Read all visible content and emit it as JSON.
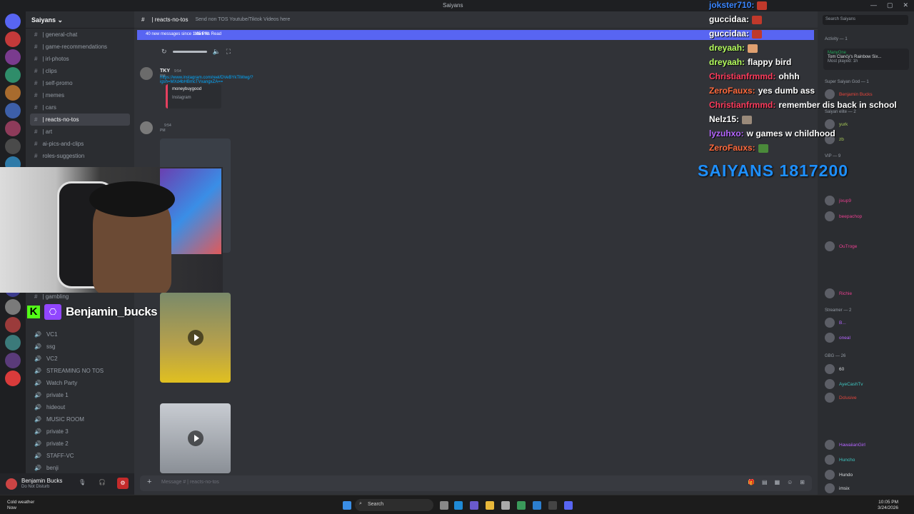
{
  "window": {
    "title": "Saiyans",
    "min": "—",
    "max": "▢",
    "close": "✕"
  },
  "guild": {
    "name": "Saiyans ⌄"
  },
  "channels": [
    {
      "name": "| general-chat"
    },
    {
      "name": "| game-recommendations"
    },
    {
      "name": "| irl-photos"
    },
    {
      "name": "| clips"
    },
    {
      "name": "| self-promo"
    },
    {
      "name": "| memes"
    },
    {
      "name": "| cars"
    },
    {
      "name": "| reacts-no-tos"
    },
    {
      "name": "| art"
    },
    {
      "name": "ai-pics-and-clips"
    },
    {
      "name": "roles-suggestion"
    }
  ],
  "gambling_channel": "| gambling",
  "voice_channels": [
    "VC1",
    "ssg",
    "VC2",
    "STREAMING NO TOS",
    "Watch Party",
    "private 1",
    "hideout",
    "MUSIC ROOM",
    "private 3",
    "private 2",
    "STAFF-VC",
    "benji"
  ],
  "user": {
    "name": "Benjamin Bucks",
    "status": "Do Not Disturb"
  },
  "channel_header": {
    "name": "| reacts-no-tos",
    "topic": "Send non TOS Youtube/Tiktok Videos here"
  },
  "new_messages": {
    "text": "40 new messages since 1:05 PM",
    "mark": "Mark As Read"
  },
  "messages": [
    {
      "author": "TKY",
      "time": "9:54 PM",
      "link": "https://www.instagram.com/reel/DVeBYkTiWwg/?igsh=MXd4bHBmcTVxangxZA==",
      "embed_author": "moneybuygood",
      "embed_site": "Instagram"
    },
    {
      "author": "",
      "time": "9:54 PM"
    }
  ],
  "composer": {
    "placeholder": "Message # | reacts-no-tos",
    "plus": "+"
  },
  "search": {
    "placeholder": "Search Saiyans"
  },
  "members": {
    "activity": "Activity — 1",
    "activity_user": "ManyOne_",
    "activity_game": "Tom Clancy's Rainbow Six...",
    "activity_sub": "Most played: 1h",
    "groups": [
      {
        "label": "Super Saiyan God — 1",
        "names": [
          "Benjamin Bucks"
        ]
      },
      {
        "label": "Saiyan elite — 2",
        "names": [
          "yurk",
          "zb"
        ]
      },
      {
        "label": "VIP — 9",
        "names": [
          "jixup9",
          "beepachop",
          "OuTroge",
          "Richie"
        ]
      },
      {
        "label": "Streamer — 2",
        "names": [
          "B...",
          "oneal"
        ]
      },
      {
        "label": "GBG — 26",
        "names": [
          "60",
          "AyeCashTv",
          "Dclusive",
          "HawaiianGirl",
          "Huncho",
          "Hundo",
          "imsix"
        ]
      }
    ]
  },
  "stream_overlay": {
    "chat": [
      {
        "user": "jokster710:",
        "msg": "",
        "color": "#3a86ff"
      },
      {
        "user": "guccidaa:",
        "msg": "",
        "color": "#ffffff"
      },
      {
        "user": "guccidaa:",
        "msg": "",
        "color": "#ffffff"
      },
      {
        "user": "dreyaah:",
        "msg": "",
        "color": "#b6ff5e"
      },
      {
        "user": "dreyaah:",
        "msg": "flappy bird",
        "color": "#b6ff5e"
      },
      {
        "user": "Christianfrmmd:",
        "msg": "ohhh",
        "color": "#ff3b5c"
      },
      {
        "user": "ZeroFauxs:",
        "msg": "yes dumb ass",
        "color": "#ff6a3d"
      },
      {
        "user": "Christianfrmmd:",
        "msg": "remember dis back in school",
        "color": "#ff3b5c"
      },
      {
        "user": "Nelz15:",
        "msg": "",
        "color": "#ffffff"
      },
      {
        "user": "lyzuhxo:",
        "msg": "w games w childhood",
        "color": "#b565ff"
      },
      {
        "user": "ZeroFauxs:",
        "msg": "",
        "color": "#ff6a3d"
      }
    ],
    "goal": "SAIYANS 1817200",
    "streamer_name": "Benjamin_bucks",
    "kick_letter": "K",
    "twitch_glyph": "⎔"
  },
  "taskbar": {
    "weather": "Cold weather",
    "weather_sub": "Now",
    "search": "Search",
    "time": "10:05 PM",
    "date": "3/24/2026"
  },
  "colors": {
    "accent": "#5865f2",
    "link": "#00a8fc",
    "goal": "#1e90ff"
  }
}
